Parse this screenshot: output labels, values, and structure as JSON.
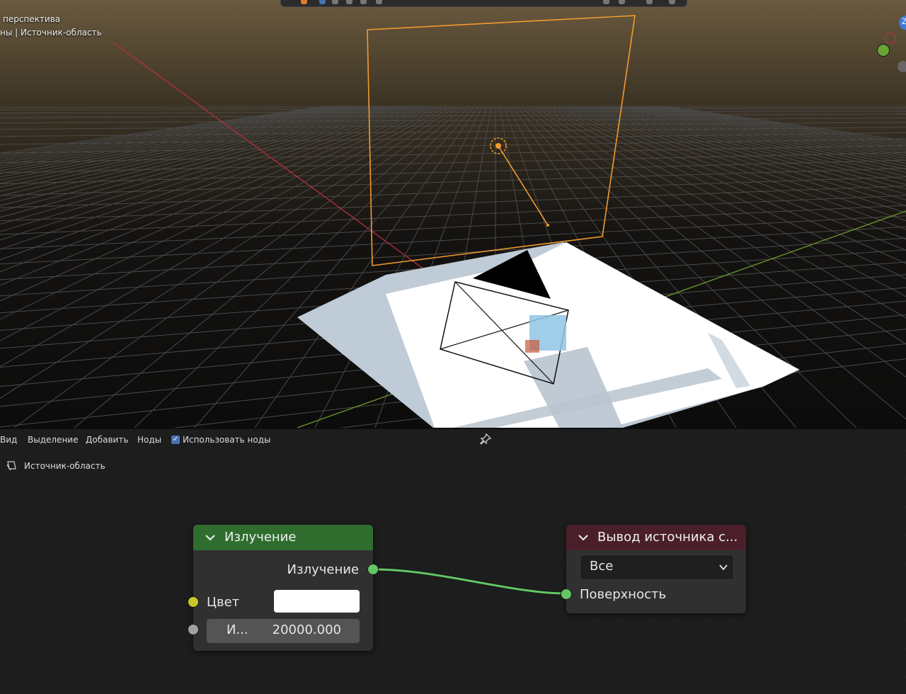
{
  "viewport": {
    "overlay_line1": "перспектива",
    "overlay_line2": "ны | Источник-область",
    "gizmo_label_z": "Z",
    "colors": {
      "selected": "#f29a2e",
      "x_axis": "#c0303b",
      "y_axis": "#6a9a2a"
    }
  },
  "node_editor": {
    "menu": {
      "view": "Вид",
      "select": "Выделение",
      "add": "Добавить",
      "nodes": "Ноды",
      "use_nodes_label": "Использовать ноды",
      "use_nodes_checked": true
    },
    "breadcrumb": {
      "icon": "light-area-icon",
      "label": "Источник-область"
    },
    "emission_node": {
      "title": "Излучение",
      "header_color": "#2f6d2f",
      "output_label": "Излучение",
      "color_label": "Цвет",
      "color_value": "#ffffff",
      "strength_label": "И...",
      "strength_value": "20000.000"
    },
    "output_node": {
      "title": "Вывод источника с...",
      "header_color": "#4a1f2a",
      "target_value": "Все",
      "surface_label": "Поверхность"
    },
    "socket_colors": {
      "shader": "#63c763",
      "color": "#c7c729",
      "float": "#a1a1a1"
    }
  }
}
